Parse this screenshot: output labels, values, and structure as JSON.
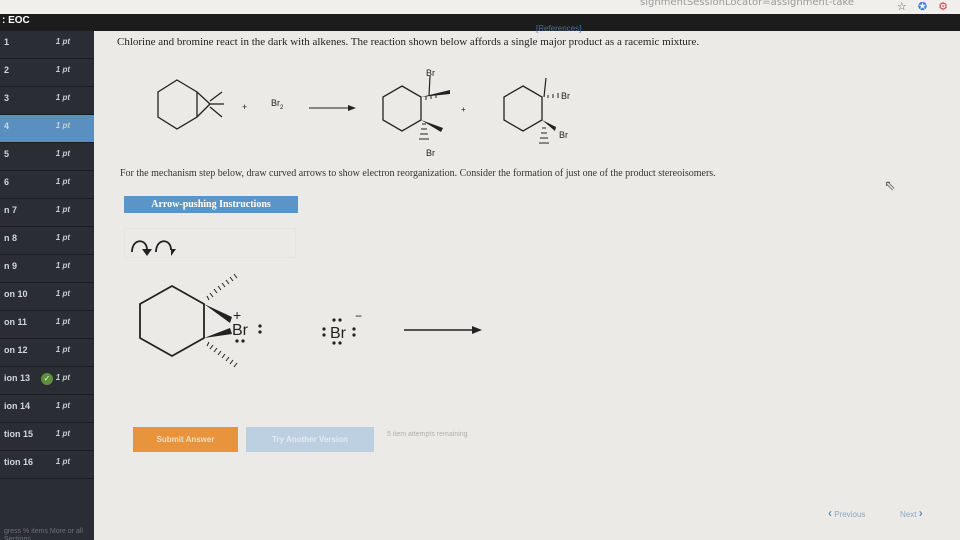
{
  "browser": {
    "url_fragment": "signmentSessionLocator=assignment-take",
    "icons": [
      "star-icon",
      "extension-icon",
      "account-icon"
    ]
  },
  "header": {
    "title": ": EOC",
    "references": "[References]"
  },
  "sidebar": {
    "items": [
      {
        "label": "1",
        "points": "1 pt"
      },
      {
        "label": "2",
        "points": "1 pt"
      },
      {
        "label": "3",
        "points": "1 pt"
      },
      {
        "label": "4",
        "points": "1 pt",
        "active": true
      },
      {
        "label": "5",
        "points": "1 pt"
      },
      {
        "label": "6",
        "points": "1 pt"
      },
      {
        "label": "n 7",
        "points": "1 pt"
      },
      {
        "label": "n 8",
        "points": "1 pt"
      },
      {
        "label": "n 9",
        "points": "1 pt"
      },
      {
        "label": "on 10",
        "points": "1 pt"
      },
      {
        "label": "on 11",
        "points": "1 pt"
      },
      {
        "label": "on 12",
        "points": "1 pt"
      },
      {
        "label": "ion 13",
        "points": "1 pt",
        "completed": true
      },
      {
        "label": "ion 14",
        "points": "1 pt"
      },
      {
        "label": "tion 15",
        "points": "1 pt"
      },
      {
        "label": "tion 16",
        "points": "1 pt"
      }
    ],
    "footer": "gress\n% items\nMore or all\nSections"
  },
  "question": {
    "intro": "Chlorine and bromine react in the dark with alkenes. The reaction shown below affords a single major product as a racemic mixture.",
    "reaction": {
      "plus1": "+",
      "reagent": "Br",
      "reagent_sub": "2",
      "plus2": "+",
      "br_p1_top": "Br",
      "br_p1_bottom": "Br",
      "br_p2_top": "Br",
      "br_p2_bottom": "Br"
    },
    "mechanism_prompt": "For the mechanism step below, draw curved arrows to show electron reorganization. Consider the formation of just one of the product stereoisomers.",
    "instructions_button": "Arrow-pushing Instructions",
    "mechanism": {
      "bromonium_label": "Br",
      "bromonium_charge": "+",
      "bromide_label": "Br",
      "bromide_charge": "−"
    }
  },
  "actions": {
    "submit": "Submit Answer",
    "retry": "Try Another Version",
    "attempts": "5 item attempts remaining",
    "previous": "Previous",
    "next": "Next"
  },
  "colors": {
    "sidebar_bg": "#2a2d33",
    "active_item": "#5a8fc0",
    "submit": "#e8943c",
    "retry": "#bdd0e2",
    "instructions": "#5b95c7",
    "check": "#5e8f3a"
  }
}
